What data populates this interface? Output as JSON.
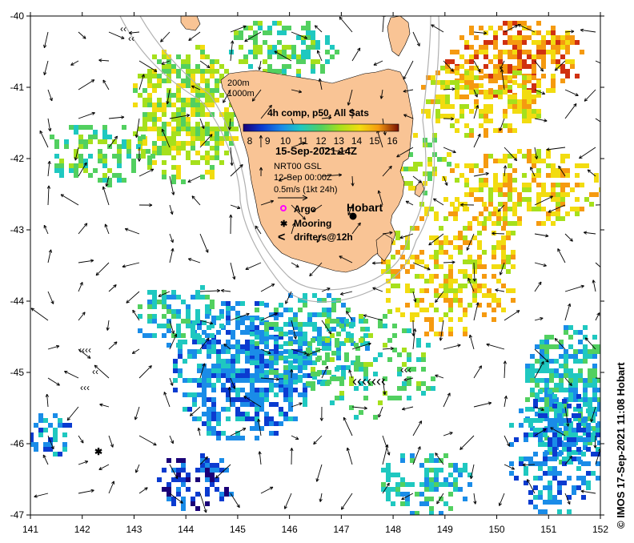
{
  "map": {
    "lon_range": [
      141,
      152
    ],
    "lat_range": [
      -47,
      -40
    ],
    "x_ticks": [
      "141",
      "142",
      "143",
      "144",
      "145",
      "146",
      "147",
      "148",
      "149",
      "150",
      "151",
      "152"
    ],
    "y_ticks": [
      "-40",
      "-41",
      "-42",
      "-43",
      "-44",
      "-45",
      "-46",
      "-47"
    ],
    "land_color": "#f9c495",
    "bathymetry_color": "#b0b0b0",
    "contours": [
      "200m",
      "1000m"
    ]
  },
  "legend": {
    "title": "4h comp, p50, All Sats",
    "scale_labels": [
      "8",
      "9",
      "10",
      "11",
      "12",
      "13",
      "14",
      "15",
      "16"
    ],
    "date": "15-Sep-2021 14Z",
    "current_source": "NRT00 GSL",
    "current_date": "12-Sep 00:00Z",
    "current_scale": "0.5m/s (1kt 24h)",
    "argo_label": "Argo",
    "mooring_label": "Mooring",
    "drifters_label": "drifters@12h",
    "argo_color": "#ff00ff",
    "drifter_color": "#ff00ff"
  },
  "places": {
    "hobart": "Hobart"
  },
  "credit": "© IMOS 17-Sep-2021 11:08 Hobart",
  "colormap": [
    "#1a0078",
    "#0b3bd0",
    "#1a8ce8",
    "#1fc8c0",
    "#52d060",
    "#a6e01c",
    "#f2dc10",
    "#f59a10",
    "#d03010",
    "#7a1000"
  ]
}
